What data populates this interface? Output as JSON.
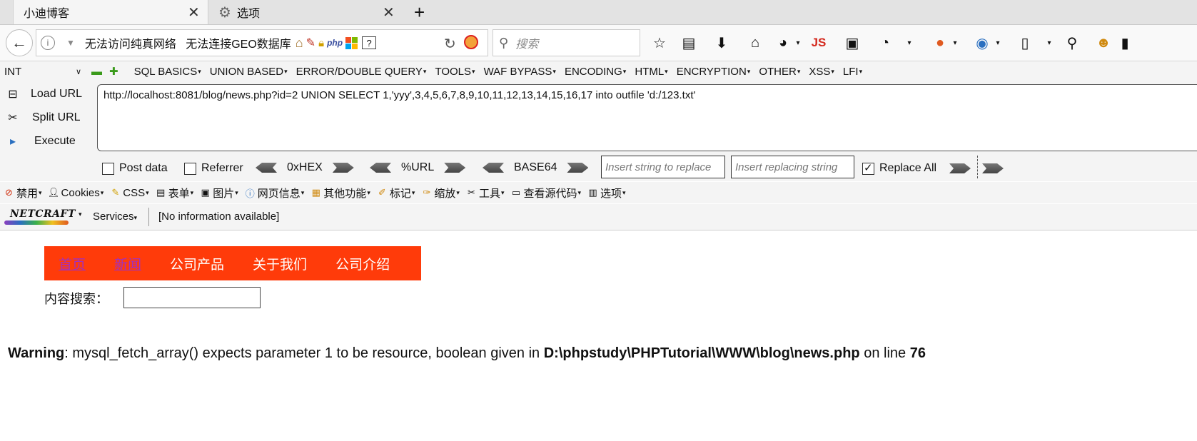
{
  "tabs": [
    {
      "label": "小迪博客",
      "active": true
    },
    {
      "label": "选项",
      "active": false
    }
  ],
  "new_tab_label": "+",
  "close_glyph": "✕",
  "urlbar": {
    "info_icon": "info-icon",
    "text": "无法访问纯真网络   无法连接GEO数据库",
    "php_label": "php",
    "qmark": "?"
  },
  "search": {
    "placeholder": "搜索"
  },
  "toolbar_js_label": "JS",
  "hackbar": {
    "type_select": "INT",
    "menu": [
      "SQL BASICS",
      "UNION BASED",
      "ERROR/DOUBLE QUERY",
      "TOOLS",
      "WAF BYPASS",
      "ENCODING",
      "HTML",
      "ENCRYPTION",
      "OTHER",
      "XSS",
      "LFI"
    ],
    "load_url": "Load URL",
    "split_url": "Split URL",
    "execute": "Execute",
    "url_value": "http://localhost:8081/blog/news.php?id=2 UNION SELECT 1,'yyy',3,4,5,6,7,8,9,10,11,12,13,14,15,16,17 into outfile 'd:/123.txt'",
    "post_data": "Post data",
    "referrer": "Referrer",
    "hex": "0xHEX",
    "url_enc": "%URL",
    "base64": "BASE64",
    "insert_string_placeholder": "Insert string to replace",
    "insert_replacing_placeholder": "Insert replacing string",
    "replace_all": "Replace All"
  },
  "webdev": [
    "禁用",
    "Cookies",
    "CSS",
    "表单",
    "图片",
    "网页信息",
    "其他功能",
    "标记",
    "缩放",
    "工具",
    "查看源代码",
    "选项"
  ],
  "netcraft": {
    "logo": "NETCRAFT",
    "services": "Services",
    "info": "[No information available]"
  },
  "page": {
    "nav": [
      "首页",
      "新闻",
      "公司产品",
      "关于我们",
      "公司介绍"
    ],
    "search_label": "内容搜索：",
    "warning_bold": "Warning",
    "warning_text": ": mysql_fetch_array() expects parameter 1 to be resource, boolean given in ",
    "warning_path": "D:\\phpstudy\\PHPTutorial\\WWW\\blog\\news.php",
    "warning_on_line": " on line ",
    "warning_line": "76"
  },
  "colors": {
    "site_nav_bg": "#ff3b0a",
    "visited_link": "#a030c0",
    "js_red": "#d42a1f"
  }
}
